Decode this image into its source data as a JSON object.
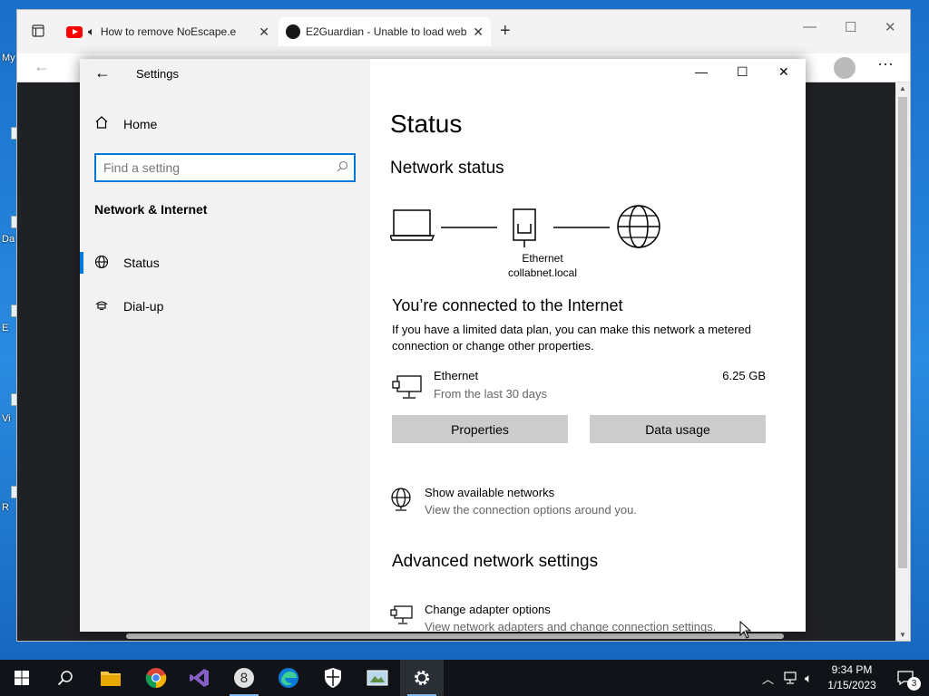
{
  "desktop": {
    "labels": [
      "My",
      "Da",
      "E",
      "Vi",
      "R"
    ]
  },
  "browser": {
    "tabs": [
      {
        "title": "How to remove NoEscape.e",
        "icon": "youtube-icon",
        "audio": true
      },
      {
        "title": "E2Guardian - Unable to load web",
        "icon": "github-icon",
        "active": true
      }
    ]
  },
  "settings": {
    "app_title": "Settings",
    "sidebar": {
      "home_label": "Home",
      "search_placeholder": "Find a setting",
      "group_title": "Network & Internet",
      "items": [
        {
          "label": "Status",
          "icon": "globe-icon",
          "selected": true
        },
        {
          "label": "Dial-up",
          "icon": "dialup-icon",
          "selected": false
        }
      ]
    },
    "main": {
      "title": "Status",
      "network_status_heading": "Network status",
      "diagram": {
        "adapter_name": "Ethernet",
        "network_name": "collabnet.local"
      },
      "connected_heading": "You’re connected to the Internet",
      "connected_desc": "If you have a limited data plan, you can make this network a metered connection or change other properties.",
      "connection": {
        "name": "Ethernet",
        "period": "From the last 30 days",
        "usage": "6.25 GB"
      },
      "buttons": {
        "properties": "Properties",
        "data_usage": "Data usage"
      },
      "show_networks": {
        "title": "Show available networks",
        "desc": "View the connection options around you."
      },
      "advanced_heading": "Advanced network settings",
      "change_adapter": {
        "title": "Change adapter options",
        "desc": "View network adapters and change connection settings."
      }
    }
  },
  "taskbar": {
    "apps": [
      "start-button",
      "search-button",
      "file-explorer",
      "chrome",
      "visual-studio",
      "app-8",
      "edge",
      "windows-security",
      "control-panel",
      "settings"
    ],
    "clock": {
      "time": "9:34 PM",
      "date": "1/15/2023"
    },
    "notification_count": "3"
  },
  "colors": {
    "accent": "#0078d7",
    "taskbar": "#101418",
    "sidebar": "#f2f2f2"
  }
}
